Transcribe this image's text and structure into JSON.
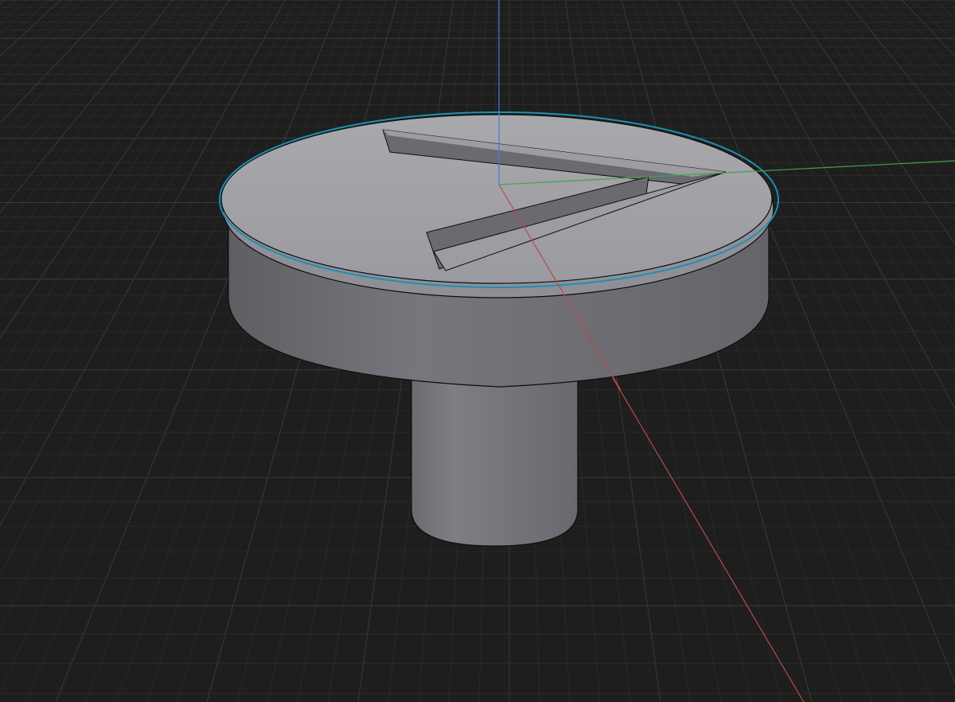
{
  "viewport": {
    "background": "#1e1e1e",
    "grid_minor_color": "#2c2c2c",
    "grid_major_color": "#3a3a3a"
  },
  "axes": {
    "x_axis_color": "#b84a4a",
    "y_axis_color": "#3fa34d",
    "z_axis_color": "#3d7fd6"
  },
  "model": {
    "name": "knob-with-arrow-indicator",
    "surface_color": "#8e8e94",
    "top_face_color": "#a9a9ae",
    "side_color": "#76767c",
    "stem_color": "#7c7c82",
    "edge_color": "#0d0d0d",
    "selection_outline_color": "#1e8fb3",
    "indicator_shape": "arrow-chevron"
  }
}
